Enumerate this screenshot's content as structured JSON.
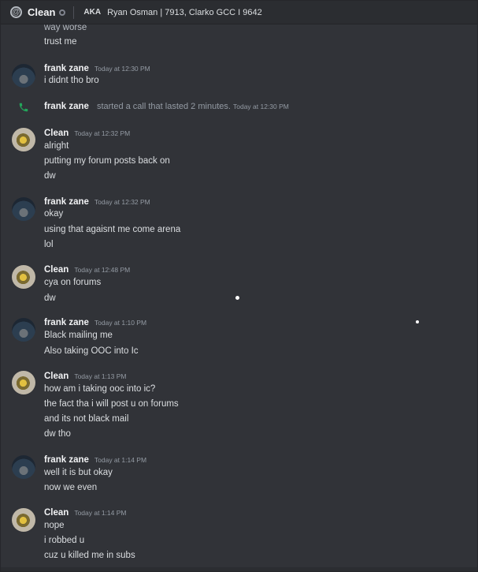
{
  "header": {
    "channel_name": "Clean",
    "aka_label": "AKA",
    "aka_text": "Ryan Osman | 7913, Clarko GCC I 9642"
  },
  "top_fragment": [
    "way worse",
    "trust me"
  ],
  "messages": [
    {
      "author": "frank zane",
      "time": "Today at 12:30 PM",
      "lines": [
        "i didnt tho bro"
      ]
    },
    {
      "author": "Clean",
      "time": "Today at 12:32 PM",
      "lines": [
        "alright",
        "putting my forum posts back on",
        "dw"
      ]
    },
    {
      "author": "frank zane",
      "time": "Today at 12:32 PM",
      "lines": [
        "okay",
        "using that agaisnt me come arena",
        "lol"
      ]
    },
    {
      "author": "Clean",
      "time": "Today at 12:48 PM",
      "lines": [
        "cya on forums",
        "dw"
      ]
    },
    {
      "author": "frank zane",
      "time": "Today at 1:10 PM",
      "lines": [
        "Black mailing me",
        "Also taking OOC into Ic"
      ]
    },
    {
      "author": "Clean",
      "time": "Today at 1:13 PM",
      "lines": [
        "how am i taking ooc into ic?",
        "the fact tha i will post u on forums",
        "and its not black mail",
        "dw tho"
      ]
    },
    {
      "author": "frank zane",
      "time": "Today at 1:14 PM",
      "lines": [
        "well it is but okay",
        "now we even"
      ]
    },
    {
      "author": "Clean",
      "time": "Today at 1:14 PM",
      "lines": [
        "nope",
        "i robbed u",
        "cuz u killed me in subs"
      ]
    }
  ],
  "call": {
    "author": "frank zane",
    "text": "started a call that lasted 2 minutes.",
    "time": "Today at 12:30 PM",
    "icon": "phone-icon"
  }
}
